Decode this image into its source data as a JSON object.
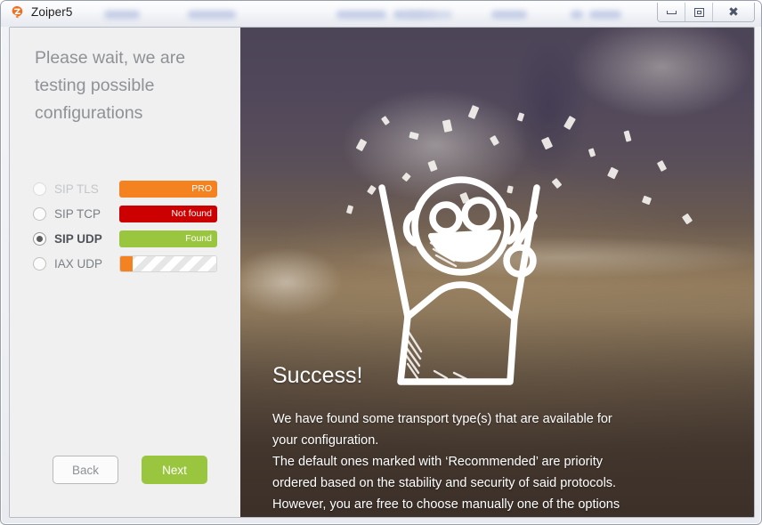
{
  "window": {
    "app_title": "Zoiper5",
    "app_icon": "zoiper-logo-icon",
    "controls": {
      "minimize": "minimize-icon",
      "maximize": "maximize-icon",
      "close": "close-icon"
    }
  },
  "wizard": {
    "heading": "Please wait, we are testing possible configurations",
    "protocols": [
      {
        "label": "SIP TLS",
        "selected": false,
        "dim": true,
        "status": "PRO",
        "bar": "pro"
      },
      {
        "label": "SIP TCP",
        "selected": false,
        "dim": false,
        "status": "Not found",
        "bar": "notfound"
      },
      {
        "label": "SIP UDP",
        "selected": true,
        "dim": false,
        "status": "Found",
        "bar": "found"
      },
      {
        "label": "IAX UDP",
        "selected": false,
        "dim": false,
        "status": "",
        "bar": "striped"
      }
    ],
    "back_label": "Back",
    "next_label": "Next"
  },
  "hero": {
    "title": "Success!",
    "lines": [
      "We have found some transport type(s) that are available for",
      "your configuration.",
      "The default ones marked with ‘Recommended’ are priority",
      "ordered based on the stability and security of said protocols.",
      "However, you are free to choose manually one of the options"
    ]
  },
  "colors": {
    "pro_orange": "#f58220",
    "notfound_red": "#cc0000",
    "found_green": "#9ac63f",
    "panel_gray": "#f0f0f0",
    "heading_gray": "#8e9297"
  }
}
